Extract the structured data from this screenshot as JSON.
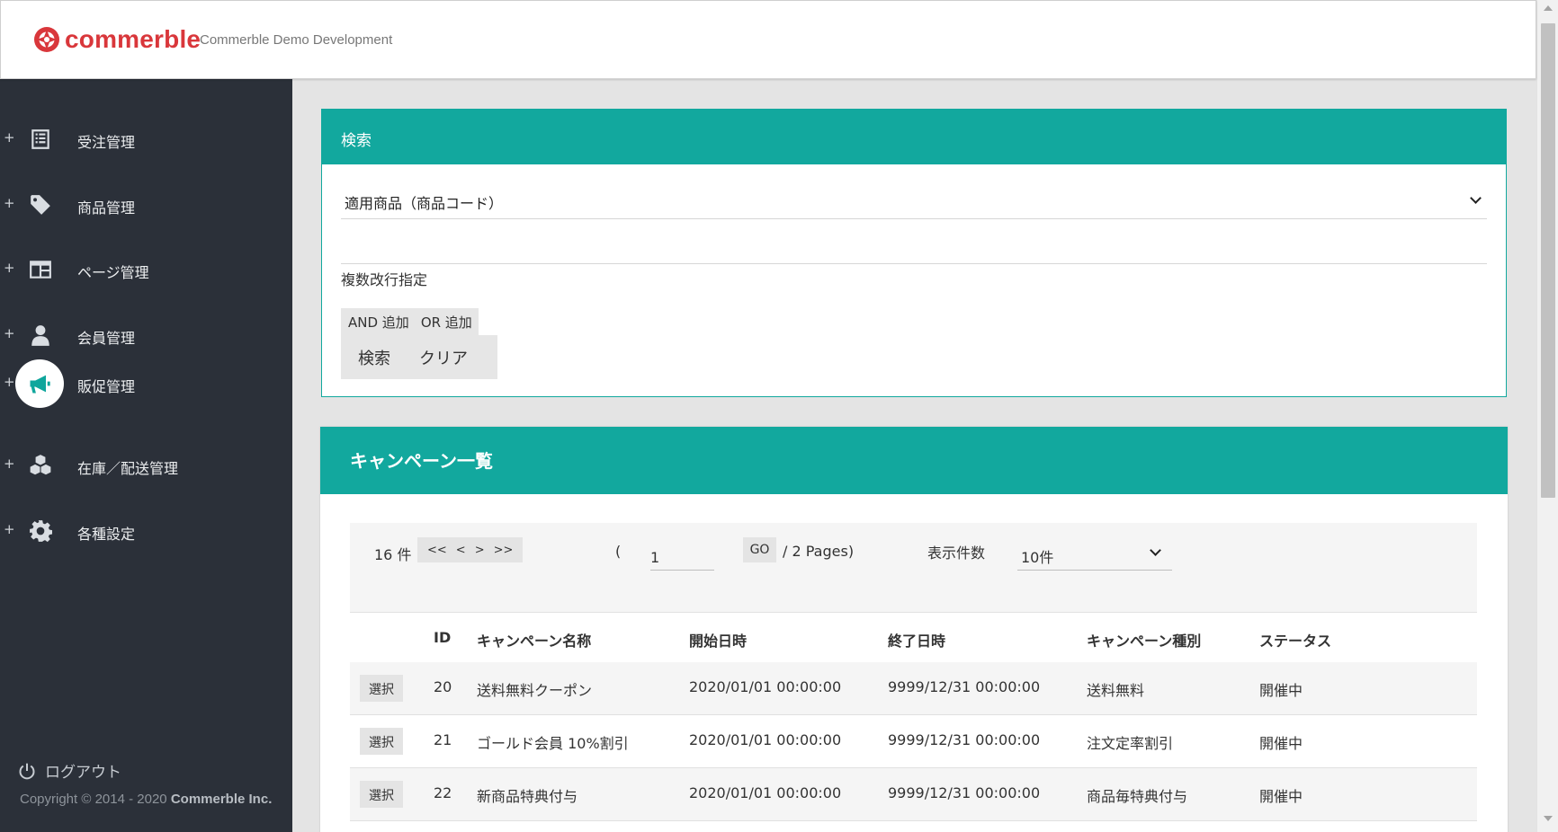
{
  "header": {
    "brand": "commerble",
    "environment": "Commerble Demo Development"
  },
  "sidebar": {
    "items": [
      {
        "label": "受注管理",
        "icon": "list-icon"
      },
      {
        "label": "商品管理",
        "icon": "tag-icon"
      },
      {
        "label": "ページ管理",
        "icon": "page-layout-icon"
      },
      {
        "label": "会員管理",
        "icon": "person-icon"
      },
      {
        "label": "販促管理",
        "icon": "megaphone-icon",
        "active": true
      },
      {
        "label": "在庫／配送管理",
        "icon": "boxes-icon"
      },
      {
        "label": "各種設定",
        "icon": "gear-icon"
      }
    ],
    "plus": "+",
    "logout": "ログアウト",
    "copyright_prefix": "Copyright © 2014 - 2020 ",
    "copyright_company": "Commerble Inc."
  },
  "search": {
    "title": "検索",
    "field_selected": "適用商品（商品コード）",
    "text_value": "",
    "hint": "複数改行指定",
    "and_label": "AND 追加",
    "or_label": "OR 追加",
    "search_label": "検索",
    "clear_label": "クリア"
  },
  "campaigns": {
    "title": "キャンペーン一覧",
    "pager": {
      "total": "16 件",
      "first": "<<",
      "prev": "<",
      "next": ">",
      "last": ">>",
      "open_paren": "(",
      "page": "1",
      "go": "GO",
      "pages_text": "/ 2 Pages)",
      "per_page_label": "表示件数",
      "per_page_value": "10件"
    },
    "columns": [
      "ID",
      "キャンペーン名称",
      "開始日時",
      "終了日時",
      "キャンペーン種別",
      "ステータス"
    ],
    "select_label": "選択",
    "rows": [
      {
        "id": "20",
        "name": "送料無料クーポン",
        "start": "2020/01/01 00:00:00",
        "end": "9999/12/31 00:00:00",
        "type": "送料無料",
        "status": "開催中"
      },
      {
        "id": "21",
        "name": "ゴールド会員 10%割引",
        "start": "2020/01/01 00:00:00",
        "end": "9999/12/31 00:00:00",
        "type": "注文定率割引",
        "status": "開催中"
      },
      {
        "id": "22",
        "name": "新商品特典付与",
        "start": "2020/01/01 00:00:00",
        "end": "9999/12/31 00:00:00",
        "type": "商品毎特典付与",
        "status": "開催中"
      }
    ]
  },
  "colors": {
    "accent": "#12a89e",
    "brand": "#d9373b",
    "sidebar_bg": "#2b3039"
  }
}
